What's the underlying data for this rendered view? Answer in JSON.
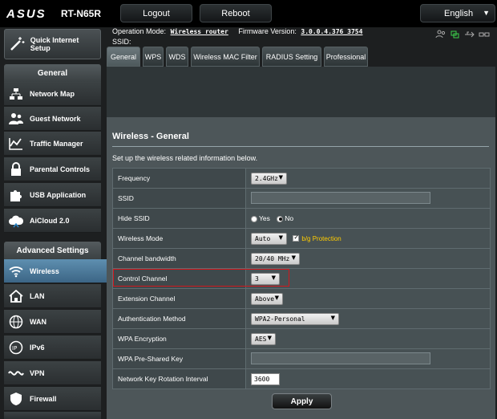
{
  "header": {
    "brand": "ASUS",
    "model": "RT-N65R",
    "logout_label": "Logout",
    "reboot_label": "Reboot",
    "language": "English"
  },
  "status": {
    "operation_mode_label": "Operation Mode:",
    "operation_mode_value": "Wireless router",
    "firmware_label": "Firmware Version:",
    "firmware_value": "3.0.0.4.376_3754",
    "ssid_label": "SSID:"
  },
  "tabs": [
    "General",
    "WPS",
    "WDS",
    "Wireless MAC Filter",
    "RADIUS Setting",
    "Professional"
  ],
  "sidebar": {
    "quick_setup": "Quick Internet Setup",
    "general_header": "General",
    "general_items": [
      "Network Map",
      "Guest Network",
      "Traffic Manager",
      "Parental Controls",
      "USB Application",
      "AiCloud 2.0"
    ],
    "advanced_header": "Advanced Settings",
    "advanced_items": [
      "Wireless",
      "LAN",
      "WAN",
      "IPv6",
      "VPN",
      "Firewall"
    ]
  },
  "panel": {
    "title": "Wireless - General",
    "subtitle": "Set up the wireless related information below.",
    "apply_label": "Apply"
  },
  "form": {
    "frequency": {
      "label": "Frequency",
      "value": "2.4GHz"
    },
    "ssid": {
      "label": "SSID",
      "value": ""
    },
    "hide_ssid": {
      "label": "Hide SSID",
      "yes": "Yes",
      "no": "No",
      "selected": "No"
    },
    "wireless_mode": {
      "label": "Wireless Mode",
      "value": "Auto",
      "protection_label": "b/g Protection",
      "protection_checked": true
    },
    "channel_bandwidth": {
      "label": "Channel bandwidth",
      "value": "20/40 MHz"
    },
    "control_channel": {
      "label": "Control Channel",
      "value": "3"
    },
    "extension_channel": {
      "label": "Extension Channel",
      "value": "Above"
    },
    "auth_method": {
      "label": "Authentication Method",
      "value": "WPA2-Personal"
    },
    "wpa_encryption": {
      "label": "WPA Encryption",
      "value": "AES"
    },
    "wpa_psk": {
      "label": "WPA Pre-Shared Key",
      "value": ""
    },
    "key_rotation": {
      "label": "Network Key Rotation Interval",
      "value": "3600"
    }
  },
  "colors": {
    "accent_active": "#4a7ea3",
    "highlight_border": "#d0171c",
    "protection_text": "#ffcc00"
  }
}
